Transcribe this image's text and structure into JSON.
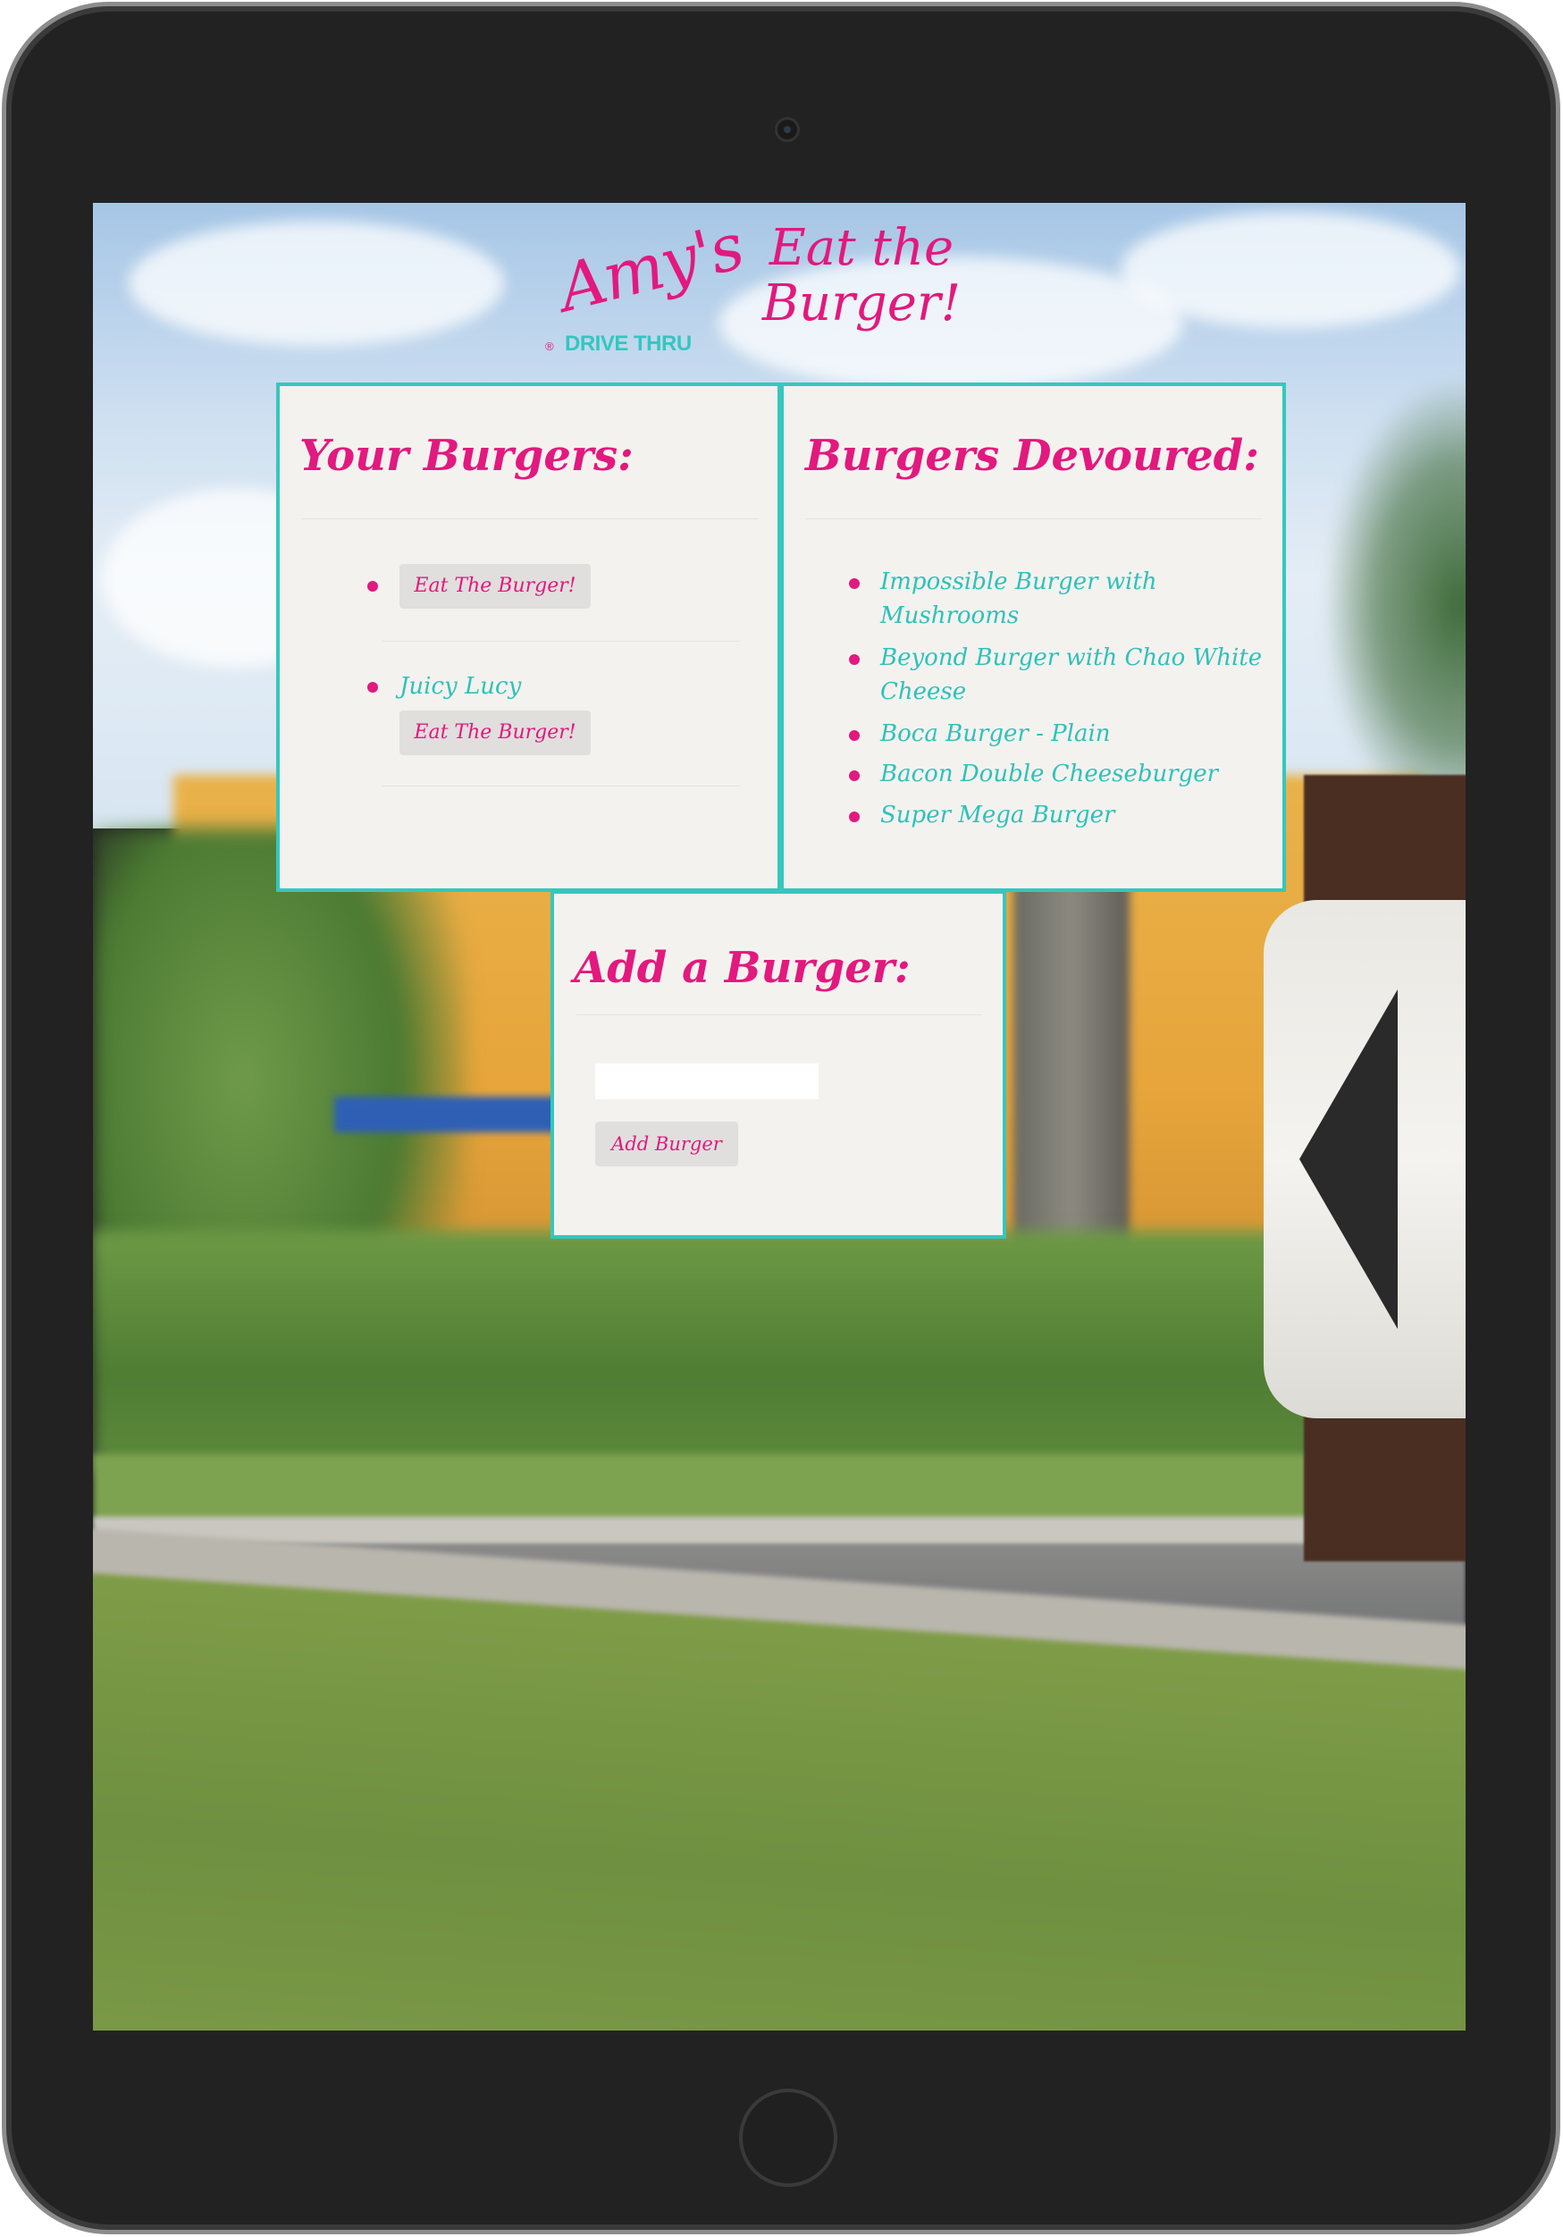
{
  "logo": {
    "script": "Amy's",
    "subtitle": "DRIVE THRU",
    "registered_mark": "®"
  },
  "page_title": "Eat the Burger!",
  "your_burgers": {
    "title": "Your Burgers:",
    "items": [
      {
        "name": "",
        "button_label": "Eat The Burger!"
      },
      {
        "name": "Juicy Lucy",
        "button_label": "Eat The Burger!"
      }
    ]
  },
  "devoured": {
    "title": "Burgers Devoured:",
    "items": [
      {
        "line1": "Impossible Burger with",
        "line2": "Mushrooms"
      },
      {
        "line1": "Beyond Burger with Chao White",
        "line2": "Cheese"
      },
      {
        "line1": "Boca Burger - Plain",
        "line2": ""
      },
      {
        "line1": "Bacon Double Cheeseburger",
        "line2": ""
      },
      {
        "line1": "Super Mega Burger",
        "line2": ""
      }
    ]
  },
  "add_burger": {
    "title": "Add a Burger:",
    "input_value": "",
    "input_placeholder": "",
    "button_label": "Add Burger"
  },
  "colors": {
    "accent_pink": "#e2197e",
    "accent_teal": "#35c7bd",
    "card_bg": "#f4f2ee"
  }
}
